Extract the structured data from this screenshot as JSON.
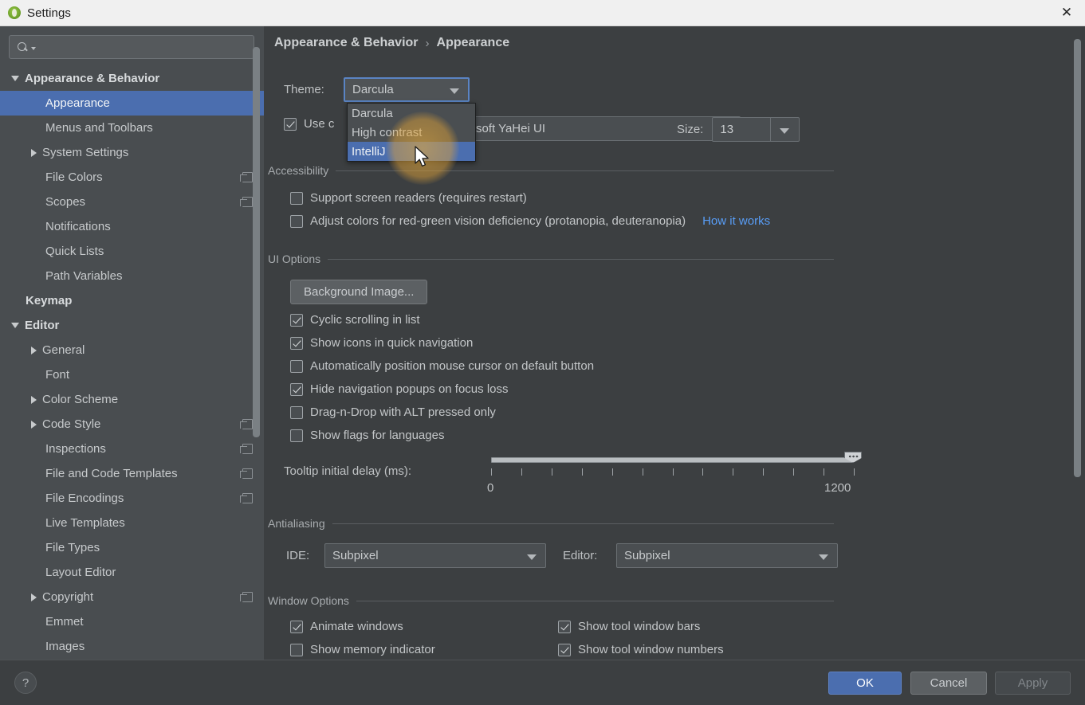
{
  "window": {
    "title": "Settings",
    "app_icon": "intellij-logo-icon",
    "close_label": "✕"
  },
  "sidebar": {
    "search": {
      "placeholder": "",
      "value": "",
      "icon": "search-icon"
    },
    "items": [
      {
        "label": "Appearance & Behavior",
        "twisty": "down",
        "indent": 0,
        "bold": true,
        "selected": false,
        "badge": false
      },
      {
        "label": "Appearance",
        "twisty": "none",
        "indent": 1,
        "bold": false,
        "selected": true,
        "badge": false
      },
      {
        "label": "Menus and Toolbars",
        "twisty": "none",
        "indent": 1,
        "bold": false,
        "selected": false,
        "badge": false
      },
      {
        "label": "System Settings",
        "twisty": "right",
        "indent": 1,
        "bold": false,
        "selected": false,
        "badge": false
      },
      {
        "label": "File Colors",
        "twisty": "none",
        "indent": 1,
        "bold": false,
        "selected": false,
        "badge": true
      },
      {
        "label": "Scopes",
        "twisty": "none",
        "indent": 1,
        "bold": false,
        "selected": false,
        "badge": true
      },
      {
        "label": "Notifications",
        "twisty": "none",
        "indent": 1,
        "bold": false,
        "selected": false,
        "badge": false
      },
      {
        "label": "Quick Lists",
        "twisty": "none",
        "indent": 1,
        "bold": false,
        "selected": false,
        "badge": false
      },
      {
        "label": "Path Variables",
        "twisty": "none",
        "indent": 1,
        "bold": false,
        "selected": false,
        "badge": false
      },
      {
        "label": "Keymap",
        "twisty": "none",
        "indent": 0,
        "bold": true,
        "selected": false,
        "badge": false
      },
      {
        "label": "Editor",
        "twisty": "down",
        "indent": 0,
        "bold": true,
        "selected": false,
        "badge": false
      },
      {
        "label": "General",
        "twisty": "right",
        "indent": 1,
        "bold": false,
        "selected": false,
        "badge": false
      },
      {
        "label": "Font",
        "twisty": "none",
        "indent": 1,
        "bold": false,
        "selected": false,
        "badge": false
      },
      {
        "label": "Color Scheme",
        "twisty": "right",
        "indent": 1,
        "bold": false,
        "selected": false,
        "badge": false
      },
      {
        "label": "Code Style",
        "twisty": "right",
        "indent": 1,
        "bold": false,
        "selected": false,
        "badge": true
      },
      {
        "label": "Inspections",
        "twisty": "none",
        "indent": 1,
        "bold": false,
        "selected": false,
        "badge": true
      },
      {
        "label": "File and Code Templates",
        "twisty": "none",
        "indent": 1,
        "bold": false,
        "selected": false,
        "badge": true
      },
      {
        "label": "File Encodings",
        "twisty": "none",
        "indent": 1,
        "bold": false,
        "selected": false,
        "badge": true
      },
      {
        "label": "Live Templates",
        "twisty": "none",
        "indent": 1,
        "bold": false,
        "selected": false,
        "badge": false
      },
      {
        "label": "File Types",
        "twisty": "none",
        "indent": 1,
        "bold": false,
        "selected": false,
        "badge": false
      },
      {
        "label": "Layout Editor",
        "twisty": "none",
        "indent": 1,
        "bold": false,
        "selected": false,
        "badge": false
      },
      {
        "label": "Copyright",
        "twisty": "right",
        "indent": 1,
        "bold": false,
        "selected": false,
        "badge": true
      },
      {
        "label": "Emmet",
        "twisty": "none",
        "indent": 1,
        "bold": false,
        "selected": false,
        "badge": false
      },
      {
        "label": "Images",
        "twisty": "none",
        "indent": 1,
        "bold": false,
        "selected": false,
        "badge": false
      }
    ]
  },
  "breadcrumb": {
    "root": "Appearance & Behavior",
    "separator": "›",
    "leaf": "Appearance"
  },
  "theme": {
    "label": "Theme:",
    "value": "Darcula",
    "dropdown_open": true,
    "options": [
      {
        "label": "Darcula",
        "highlighted": false
      },
      {
        "label": "High contrast",
        "highlighted": false
      },
      {
        "label": "IntelliJ",
        "highlighted": true
      }
    ]
  },
  "font_row": {
    "custom_font_checkbox": {
      "label": "Use c",
      "checked": true
    },
    "font_value": "soft YaHei UI",
    "size_label": "Size:",
    "size_value": "13"
  },
  "accessibility": {
    "title": "Accessibility",
    "options": [
      {
        "label": "Support screen readers (requires restart)",
        "checked": false
      },
      {
        "label": "Adjust colors for red-green vision deficiency (protanopia, deuteranopia)",
        "checked": false
      }
    ],
    "link": "How it works"
  },
  "ui_options": {
    "title": "UI Options",
    "background_image_button": "Background Image...",
    "options": [
      {
        "label": "Cyclic scrolling in list",
        "checked": true
      },
      {
        "label": "Show icons in quick navigation",
        "checked": true
      },
      {
        "label": "Automatically position mouse cursor on default button",
        "checked": false
      },
      {
        "label": "Hide navigation popups on focus loss",
        "checked": true
      },
      {
        "label": "Drag-n-Drop with ALT pressed only",
        "checked": false
      },
      {
        "label": "Show flags for languages",
        "checked": false
      }
    ],
    "tooltip_slider": {
      "label": "Tooltip initial delay (ms):",
      "min_label": "0",
      "max_label": "1200",
      "min": 0,
      "max": 1200,
      "value": 1200,
      "tick_count": 13
    }
  },
  "antialiasing": {
    "title": "Antialiasing",
    "ide_label": "IDE:",
    "ide_value": "Subpixel",
    "editor_label": "Editor:",
    "editor_value": "Subpixel"
  },
  "window_options": {
    "title": "Window Options",
    "left": [
      {
        "label": "Animate windows",
        "checked": true
      },
      {
        "label": "Show memory indicator",
        "checked": false
      }
    ],
    "right": [
      {
        "label": "Show tool window bars",
        "checked": true
      },
      {
        "label": "Show tool window numbers",
        "checked": true
      }
    ]
  },
  "footer": {
    "help": "?",
    "ok": "OK",
    "cancel": "Cancel",
    "apply": "Apply"
  },
  "colors": {
    "accent": "#4b6eaf",
    "panel_bg": "#3c3f41",
    "sidebar_bg": "#494d50",
    "link": "#589df6",
    "click_highlight": "#e6aa3c"
  }
}
